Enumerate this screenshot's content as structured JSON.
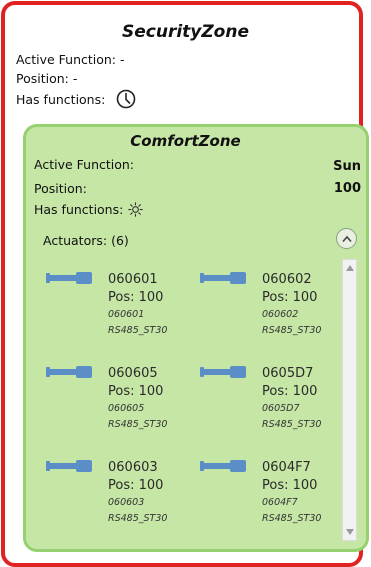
{
  "security_zone": {
    "title": "SecurityZone",
    "active_function_line": "Active Function: -",
    "position_line": "Position: -",
    "has_functions_label": "Has functions:",
    "function_icon": "clock-icon",
    "border_color": "#e02222"
  },
  "comfort_zone": {
    "title": "ComfortZone",
    "active_function_label": "Active Function:",
    "active_function_value": "Sun",
    "position_label": "Position:",
    "position_value": "100",
    "has_functions_label": "Has functions:",
    "function_icon": "sun-icon",
    "background_color": "#c6e6a6",
    "border_color": "#96d070"
  },
  "actuators": {
    "label": "Actuators: (6)",
    "collapse_icon": "chevron-up-icon",
    "items": [
      {
        "name": "060601",
        "pos": "Pos: 100",
        "id": "060601",
        "type": "RS485_ST30"
      },
      {
        "name": "060602",
        "pos": "Pos: 100",
        "id": "060602",
        "type": "RS485_ST30"
      },
      {
        "name": "060605",
        "pos": "Pos: 100",
        "id": "060605",
        "type": "RS485_ST30"
      },
      {
        "name": "0605D7",
        "pos": "Pos: 100",
        "id": "0605D7",
        "type": "RS485_ST30"
      },
      {
        "name": "060603",
        "pos": "Pos: 100",
        "id": "060603",
        "type": "RS485_ST30"
      },
      {
        "name": "0604F7",
        "pos": "Pos: 100",
        "id": "0604F7",
        "type": "RS485_ST30"
      }
    ],
    "icon": "actuator-icon",
    "icon_color": "#5b8ec7"
  }
}
